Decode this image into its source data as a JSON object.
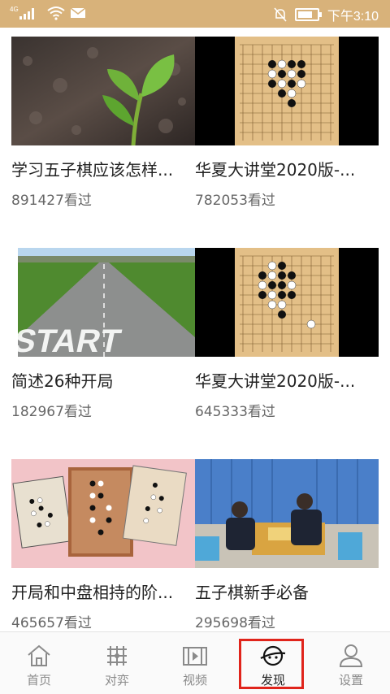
{
  "status_bar": {
    "network": "4G",
    "time": "下午3:10",
    "battery_level": 0.75
  },
  "cards": [
    {
      "title": "学习五子棋应该怎样...",
      "views": "891427看过",
      "thumb": "seedling"
    },
    {
      "title": "华夏大讲堂2020版-...",
      "views": "782053看过",
      "thumb": "gomoku-board"
    },
    {
      "title": "简述26种开局",
      "views": "182967看过",
      "thumb": "start-road"
    },
    {
      "title": "华夏大讲堂2020版-...",
      "views": "645333看过",
      "thumb": "gomoku-board"
    },
    {
      "title": "开局和中盘相持的阶...",
      "views": "465657看过",
      "thumb": "three-boards"
    },
    {
      "title": "五子棋新手必备",
      "views": "295698看过",
      "thumb": "players-table"
    }
  ],
  "tabs": [
    {
      "label": "首页",
      "icon": "home-icon"
    },
    {
      "label": "对弈",
      "icon": "board-grid-icon"
    },
    {
      "label": "视频",
      "icon": "video-icon"
    },
    {
      "label": "发现",
      "icon": "planet-icon",
      "active": true
    },
    {
      "label": "设置",
      "icon": "person-icon"
    }
  ],
  "colors": {
    "status_bar": "#d8b27a",
    "highlight": "#e0241b",
    "board": "#e3bf87"
  }
}
